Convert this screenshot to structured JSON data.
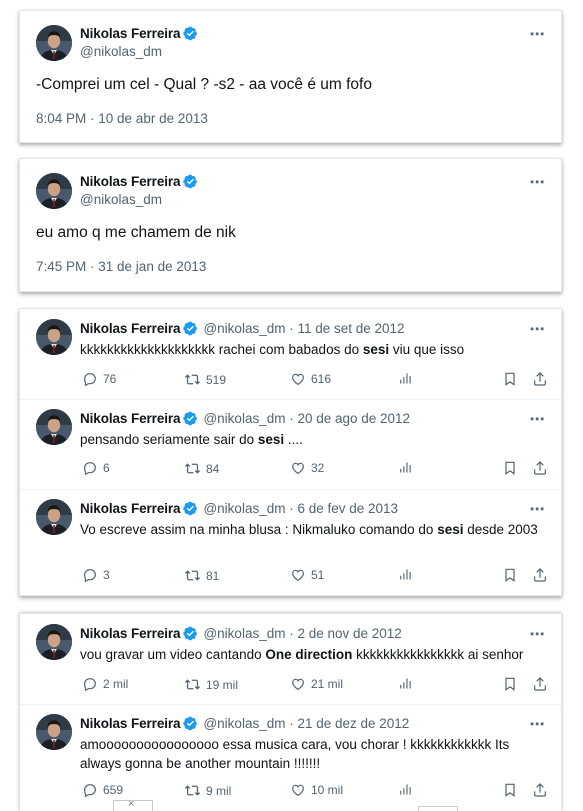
{
  "author": {
    "name": "Nikolas Ferreira",
    "handle": "@nikolas_dm",
    "verified_color": "#1d9bf0"
  },
  "cards": {
    "single1": {
      "text": "-Comprei um cel - Qual ? -s2 - aa você é um fofo",
      "timestamp": "8:04 PM · 10 de abr de 2013"
    },
    "single2": {
      "text": "eu amo q me chamem de nik",
      "timestamp": "7:45 PM · 31 de jan de 2013"
    }
  },
  "timeline1": [
    {
      "meta": "@nikolas_dm · 11 de set de 2012",
      "text_before": "kkkkkkkkkkkkkkkkkkkk rachei com babados do ",
      "text_bold": "sesi",
      "text_after": " viu que isso",
      "replies": "76",
      "retweets": "519",
      "likes": "616"
    },
    {
      "meta": "@nikolas_dm · 20 de ago de 2012",
      "text_before": "pensando seriamente sair do ",
      "text_bold": "sesi",
      "text_after": " ....",
      "replies": "6",
      "retweets": "84",
      "likes": "32"
    },
    {
      "meta": "@nikolas_dm · 6 de fev de 2013",
      "text_before": "Vo escreve assim na minha blusa : Nikmaluko comando do ",
      "text_bold": "sesi",
      "text_after": " desde 2003",
      "replies": "3",
      "retweets": "81",
      "likes": "51"
    }
  ],
  "timeline2": [
    {
      "meta": "@nikolas_dm · 2 de nov de 2012",
      "text_before": "vou gravar um video cantando ",
      "text_bold": "One direction",
      "text_after": " kkkkkkkkkkkkkkkk ai senhor",
      "replies": "2 mil",
      "retweets": "19 mil",
      "likes": "21 mil"
    },
    {
      "meta": "@nikolas_dm · 21 de dez de 2012",
      "text_before": "amoooooooooooooooo essa musica cara, vou chorar ! kkkkkkkkkkkk Its always gonna be another mountain !!!!!!!",
      "text_bold": "",
      "text_after": "",
      "replies": "659",
      "retweets": "9 mil",
      "likes": "10 mil"
    }
  ],
  "icons": {
    "more": "⋯",
    "close": "×"
  }
}
